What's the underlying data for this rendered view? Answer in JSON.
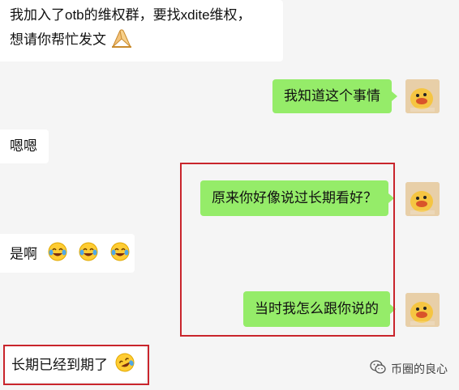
{
  "messages": [
    {
      "side": "left",
      "line1": "我加入了otb的维权群，要找xdite维权，",
      "line2": "想请你帮忙发文"
    },
    {
      "side": "right",
      "text": "我知道这个事情"
    },
    {
      "side": "left",
      "text": "嗯嗯"
    },
    {
      "side": "right",
      "text": "原来你好像说过长期看好？"
    },
    {
      "side": "left",
      "text": "是啊"
    },
    {
      "side": "right",
      "text": "当时我怎么跟你说的"
    },
    {
      "side": "left",
      "text": "长期已经到期了"
    }
  ],
  "avatar": {
    "icon": "duck-avatar-icon"
  },
  "watermark": {
    "icon": "wechat-icon",
    "text": "币圈的良心"
  },
  "colors": {
    "background": "#f5f5f5",
    "incoming_bubble": "#ffffff",
    "outgoing_bubble": "#95ec69",
    "highlight_box": "#c9252c"
  }
}
